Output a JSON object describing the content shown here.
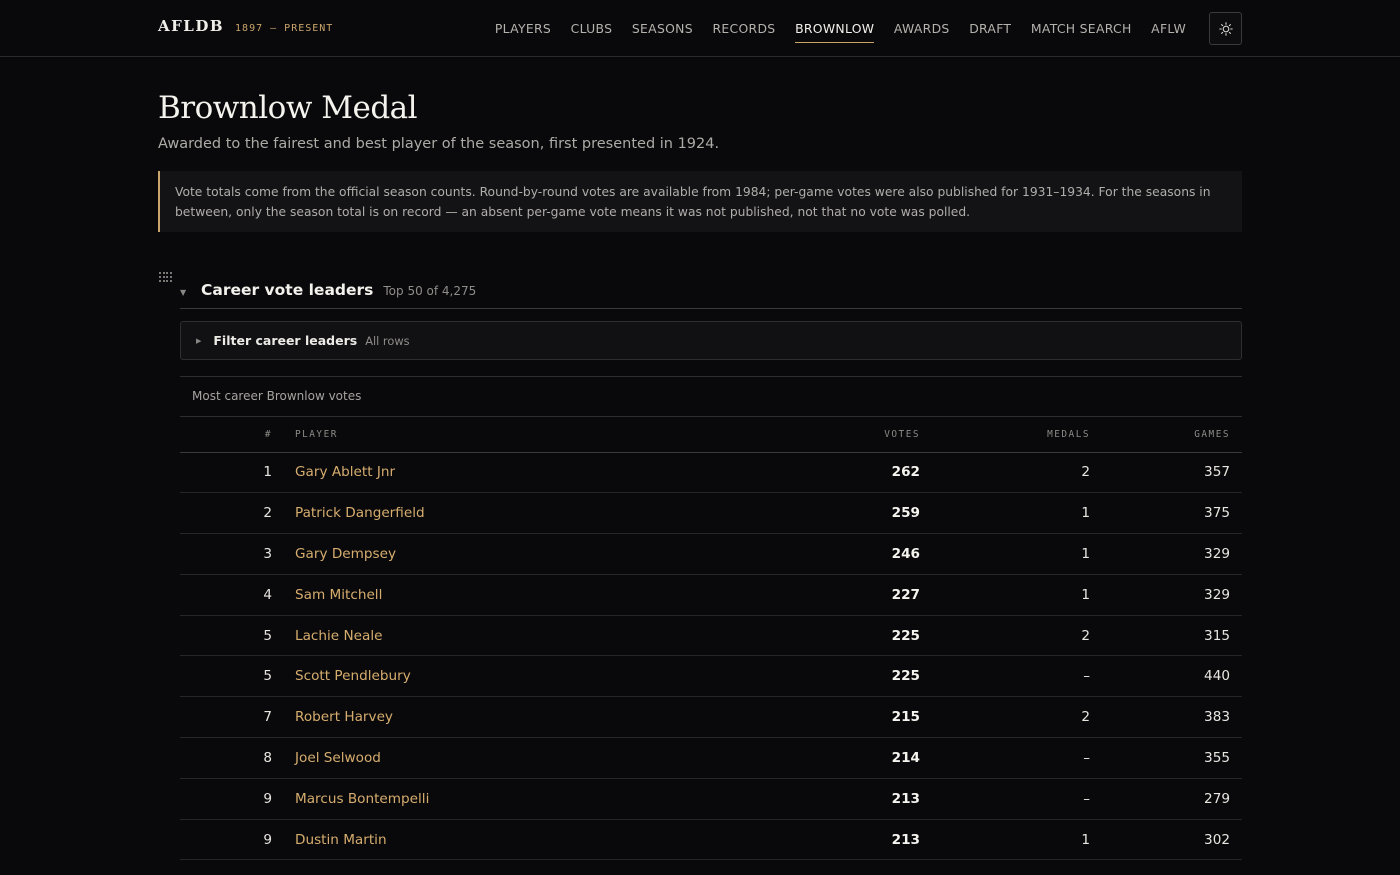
{
  "header": {
    "brand": "AFLDB",
    "range": "1897 — PRESENT",
    "nav": [
      "PLAYERS",
      "CLUBS",
      "SEASONS",
      "RECORDS",
      "BROWNLOW",
      "AWARDS",
      "DRAFT",
      "MATCH SEARCH",
      "AFLW"
    ],
    "active_nav": "BROWNLOW",
    "theme_icon": "sun-icon"
  },
  "page": {
    "title": "Brownlow Medal",
    "subtitle": "Awarded to the fairest and best player of the season, first presented in 1924.",
    "note": "Vote totals come from the official season counts. Round-by-round votes are available from 1984; per-game votes were also published for 1931–1934. For the seasons in between, only the season total is on record — an absent per-game vote means it was not published, not that no vote was polled."
  },
  "section": {
    "title": "Career vote leaders",
    "count": "Top 50 of 4,275",
    "filter_title": "Filter career leaders",
    "filter_sub": "All rows",
    "caption": "Most career Brownlow votes"
  },
  "table": {
    "columns": {
      "rank": "#",
      "player": "PLAYER",
      "votes": "VOTES",
      "medals": "MEDALS",
      "games": "GAMES"
    },
    "rows": [
      {
        "rank": "1",
        "player": "Gary Ablett Jnr",
        "votes": "262",
        "medals": "2",
        "games": "357"
      },
      {
        "rank": "2",
        "player": "Patrick Dangerfield",
        "votes": "259",
        "medals": "1",
        "games": "375"
      },
      {
        "rank": "3",
        "player": "Gary Dempsey",
        "votes": "246",
        "medals": "1",
        "games": "329"
      },
      {
        "rank": "4",
        "player": "Sam Mitchell",
        "votes": "227",
        "medals": "1",
        "games": "329"
      },
      {
        "rank": "5",
        "player": "Lachie Neale",
        "votes": "225",
        "medals": "2",
        "games": "315"
      },
      {
        "rank": "5",
        "player": "Scott Pendlebury",
        "votes": "225",
        "medals": "–",
        "games": "440"
      },
      {
        "rank": "7",
        "player": "Robert Harvey",
        "votes": "215",
        "medals": "2",
        "games": "383"
      },
      {
        "rank": "8",
        "player": "Joel Selwood",
        "votes": "214",
        "medals": "–",
        "games": "355"
      },
      {
        "rank": "9",
        "player": "Marcus Bontempelli",
        "votes": "213",
        "medals": "–",
        "games": "279"
      },
      {
        "rank": "9",
        "player": "Dustin Martin",
        "votes": "213",
        "medals": "1",
        "games": "302"
      }
    ]
  }
}
